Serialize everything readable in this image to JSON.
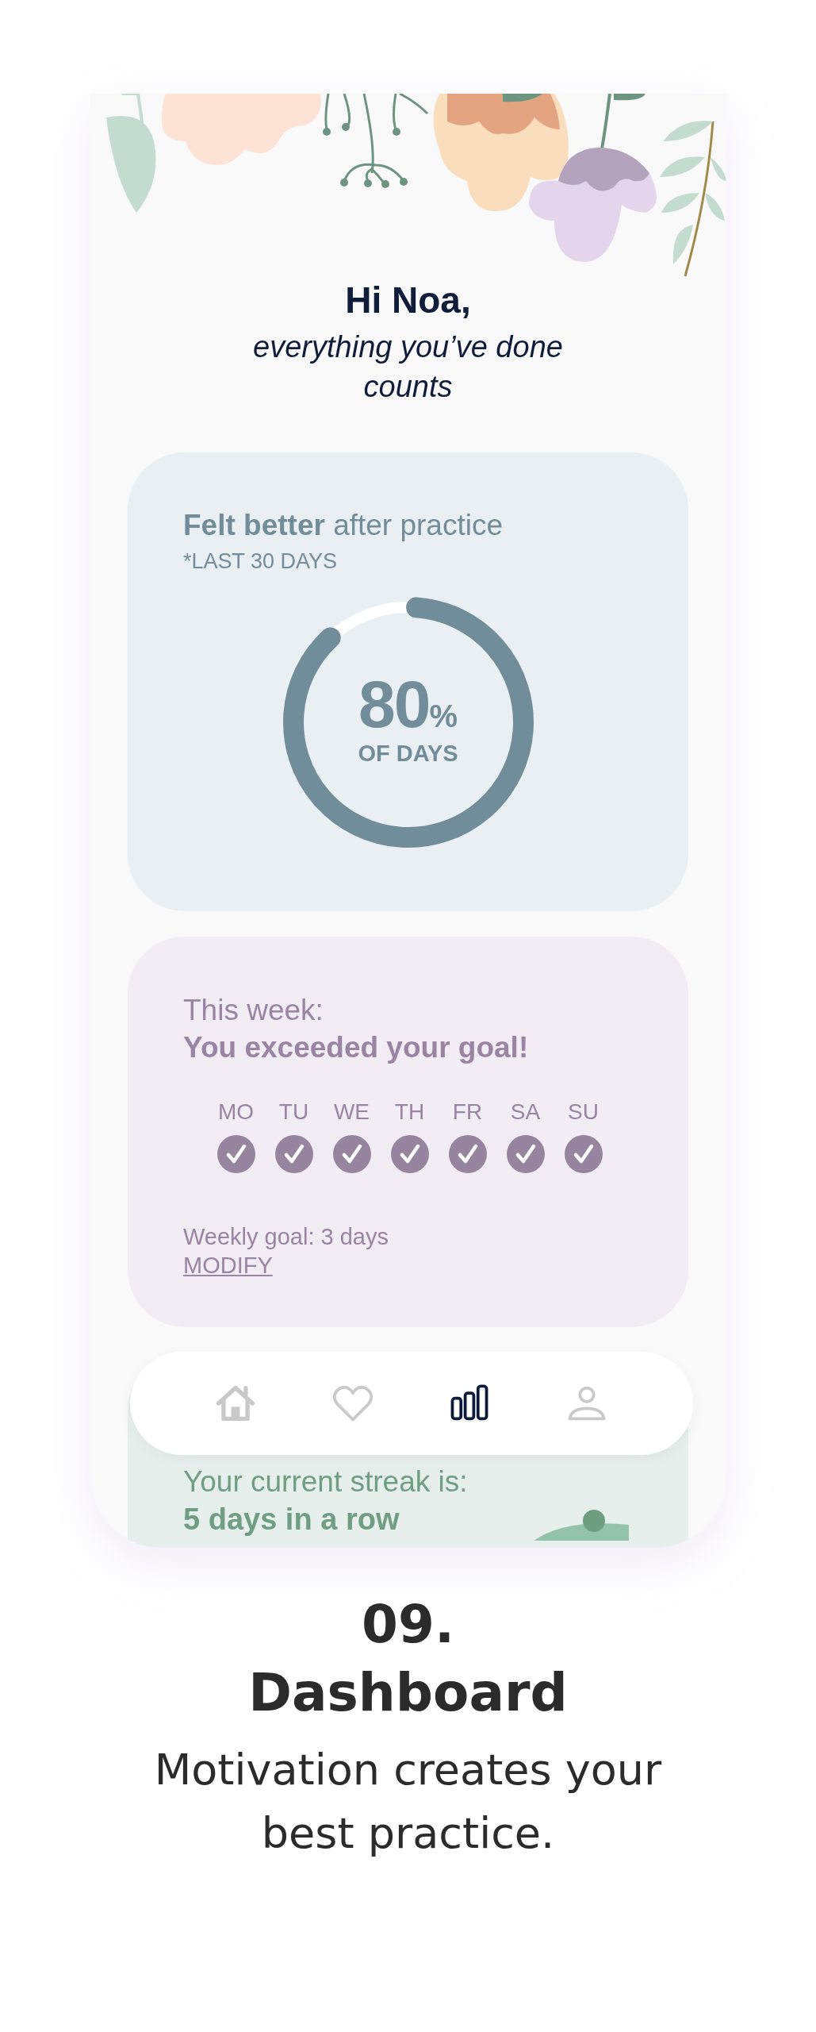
{
  "greeting": {
    "title": "Hi Noa,",
    "subtitle": "everything you’ve done counts"
  },
  "feeling_card": {
    "title": "**Felt better** after practice",
    "note": "*LAST 30 DAYS",
    "level": 0.87,
    "value": "80",
    "unit": "%",
    "caption": "OF DAYS"
  },
  "week_card": {
    "heading": "This week:",
    "message": "You exceeded your goal!",
    "days": [
      {
        "label": "MO",
        "checked": true
      },
      {
        "label": "TU",
        "checked": true
      },
      {
        "label": "WE",
        "checked": true
      },
      {
        "label": "TH",
        "checked": true
      },
      {
        "label": "FR",
        "checked": true
      },
      {
        "label": "SA",
        "checked": true
      },
      {
        "label": "SU",
        "checked": true
      }
    ],
    "goal": "Weekly goal: 3 days",
    "link": "MODIFY"
  },
  "nav": [
    {
      "kind": "home",
      "selected": false
    },
    {
      "kind": "heart",
      "selected": false
    },
    {
      "kind": "stats",
      "selected": true
    },
    {
      "kind": "profile",
      "selected": false
    }
  ],
  "streak_card": {
    "heading": "Your current streak is:",
    "value": "5 days in a row"
  },
  "caption": {
    "number": "09.",
    "title": "Dashboard",
    "text": "Motivation creates your best practice."
  }
}
